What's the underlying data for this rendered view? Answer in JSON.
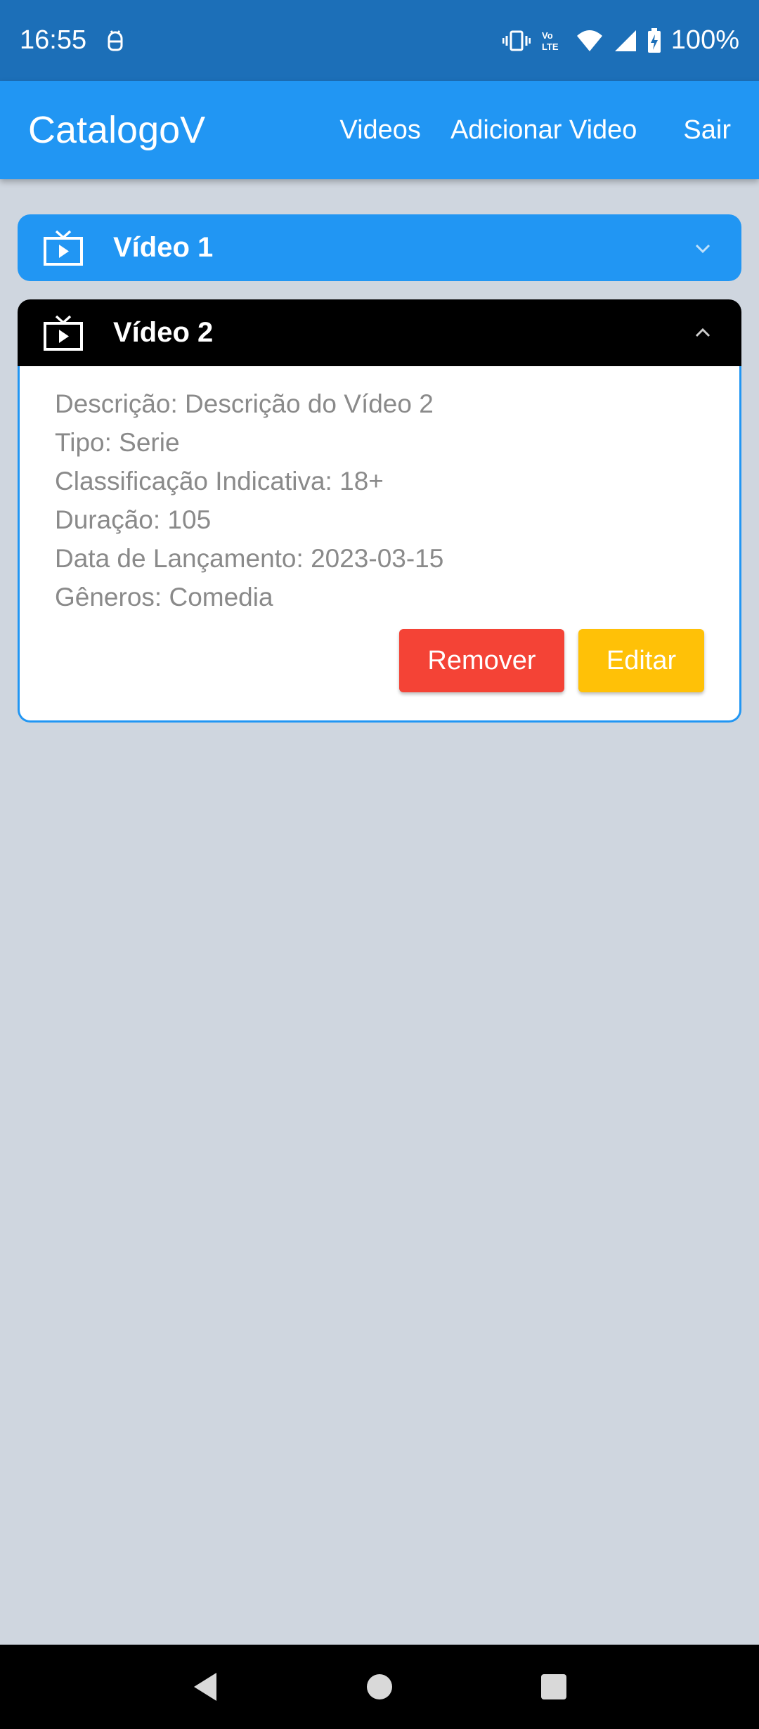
{
  "status_bar": {
    "time": "16:55",
    "battery": "100%",
    "icons": [
      "android-debug-icon",
      "vibrate-icon",
      "volte-icon",
      "wifi-icon",
      "signal-icon",
      "battery-charging-icon"
    ]
  },
  "app_bar": {
    "title": "CatalogoV",
    "nav": {
      "videos": "Videos",
      "add_video": "Adicionar Video",
      "logout": "Sair"
    }
  },
  "videos": [
    {
      "title": "Vídeo 1",
      "expanded": false
    },
    {
      "title": "Vídeo 2",
      "expanded": true,
      "details": {
        "description": "Descrição: Descrição do Vídeo 2",
        "type": "Tipo: Serie",
        "rating": "Classificação Indicativa: 18+",
        "duration": "Duração: 105",
        "release_date": "Data de Lançamento: 2023-03-15",
        "genres": "Gêneros:  Comedia"
      },
      "actions": {
        "remove": "Remover",
        "edit": "Editar"
      }
    }
  ],
  "colors": {
    "primary": "#2196f3",
    "status_bar": "#1c6fb8",
    "background": "#cfd6df",
    "remove": "#f44336",
    "edit": "#ffc107"
  }
}
